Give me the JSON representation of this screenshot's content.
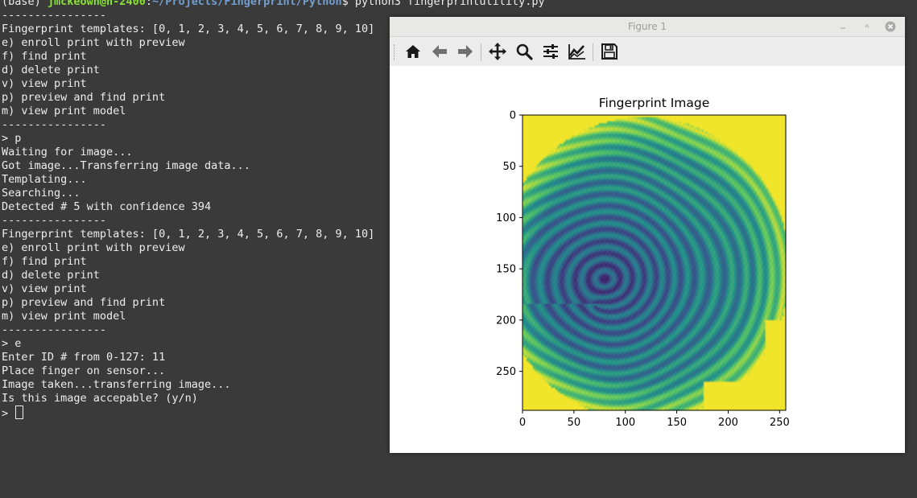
{
  "terminal": {
    "prompt": {
      "env": "(base) ",
      "user": "jmckeown@h-2400",
      "sep": ":",
      "path": "~/Projects/Fingerprint/Python",
      "cmd": "$ python3 fingerprintutility.py"
    },
    "lines": [
      "----------------",
      "Fingerprint templates: [0, 1, 2, 3, 4, 5, 6, 7, 8, 9, 10]",
      "e) enroll print with preview",
      "f) find print",
      "d) delete print",
      "v) view print",
      "p) preview and find print",
      "m) view print model",
      "----------------",
      "> p",
      "Waiting for image...",
      "Got image...Transferring image data...",
      "Templating...",
      "Searching...",
      "Detected # 5 with confidence 394",
      "----------------",
      "Fingerprint templates: [0, 1, 2, 3, 4, 5, 6, 7, 8, 9, 10]",
      "e) enroll print with preview",
      "f) find print",
      "d) delete print",
      "v) view print",
      "p) preview and find print",
      "m) view print model",
      "----------------",
      "> e",
      "Enter ID # from 0-127: 11",
      "Place finger on sensor...",
      "Image taken...transferring image...",
      "Is this image accepable? (y/n)"
    ],
    "input_prompt": "> "
  },
  "figure": {
    "window_title": "Figure 1",
    "toolbar": [
      {
        "name": "home-button",
        "icon": "home-icon"
      },
      {
        "name": "back-button",
        "icon": "arrow-left-icon"
      },
      {
        "name": "forward-button",
        "icon": "arrow-right-icon"
      },
      {
        "name": "pan-button",
        "icon": "move-icon"
      },
      {
        "name": "zoom-button",
        "icon": "magnifier-icon"
      },
      {
        "name": "subplots-button",
        "icon": "sliders-icon"
      },
      {
        "name": "edit-axis-button",
        "icon": "line-chart-icon"
      },
      {
        "name": "save-button",
        "icon": "floppy-icon"
      }
    ]
  },
  "chart_data": {
    "type": "heatmap",
    "title": "Fingerprint Image",
    "xlabel": "",
    "ylabel": "",
    "x_ticks": [
      0,
      50,
      100,
      150,
      200,
      250
    ],
    "y_ticks": [
      0,
      50,
      100,
      150,
      200,
      250
    ],
    "xlim": [
      0,
      256
    ],
    "ylim": [
      288,
      0
    ],
    "colormap": "viridis",
    "colors": {
      "low": "#440154",
      "mid": "#21918c",
      "high": "#fde725"
    }
  }
}
